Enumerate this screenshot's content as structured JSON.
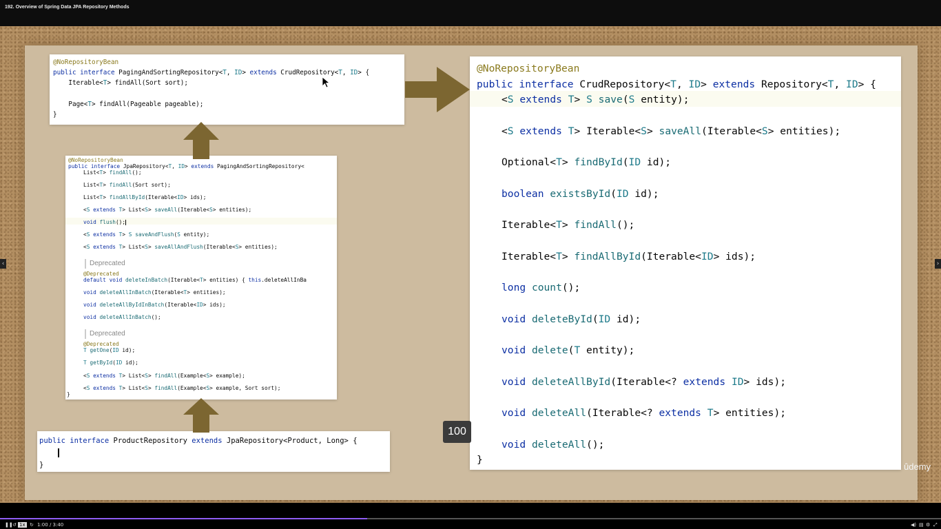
{
  "video": {
    "title": "192. Overview of Spring Data JPA Repository Methods",
    "speed_badge": "100",
    "watermark": "ûdemy",
    "progress": 0.39,
    "playback_rate": "1x",
    "time": "1:00 / 3:40"
  },
  "paging_panel": {
    "annotation": "@NoRepositoryBean",
    "decl": [
      "public interface ",
      "PagingAndSortingRepository",
      "<",
      "T",
      ", ",
      "ID",
      "> ",
      "extends",
      " CrudRepository<",
      "T",
      ", ",
      "ID",
      "> {"
    ],
    "lines": [
      [
        "    Iterable<",
        "T",
        "> findAll(Sort sort);"
      ],
      [
        "    Page<",
        "T",
        "> findAll(Pageable pageable);"
      ]
    ],
    "close": "}"
  },
  "jpa_panel": {
    "annotation": "@NoRepositoryBean",
    "decl": [
      "public interface ",
      "JpaRepository<",
      "T",
      ", ",
      "ID",
      "> ",
      "extends",
      " PagingAndSortingRepository<"
    ],
    "lines": [
      [
        "List<",
        "T",
        "> ",
        "findAll",
        "();"
      ],
      [
        "List<",
        "T",
        "> ",
        "findAll",
        "(Sort sort);"
      ],
      [
        "List<",
        "T",
        "> ",
        "findAllById",
        "(Iterable<",
        "ID",
        "> ids);"
      ],
      [
        "<",
        "S",
        " ",
        "extends",
        " ",
        "T",
        "> List<",
        "S",
        "> ",
        "saveAll",
        "(Iterable<",
        "S",
        "> entities);"
      ],
      [
        "void",
        " ",
        "flush",
        "();"
      ],
      [
        "<",
        "S",
        " ",
        "extends",
        " ",
        "T",
        "> ",
        "S",
        " ",
        "saveAndFlush",
        "(",
        "S",
        " entity);"
      ],
      [
        "<",
        "S",
        " ",
        "extends",
        " ",
        "T",
        "> List<",
        "S",
        "> ",
        "saveAllAndFlush",
        "(Iterable<",
        "S",
        "> entities);"
      ],
      [
        "default",
        " ",
        "void",
        " ",
        "deleteInBatch",
        "(Iterable<",
        "T",
        "> entities) { ",
        "this",
        ".deleteAllInBa"
      ],
      [
        "void",
        " ",
        "deleteAllInBatch",
        "(Iterable<",
        "T",
        "> entities);"
      ],
      [
        "void",
        " ",
        "deleteAllByIdInBatch",
        "(Iterable<",
        "ID",
        "> ids);"
      ],
      [
        "void",
        " ",
        "deleteAllInBatch",
        "();"
      ],
      [
        "T",
        " ",
        "getOne",
        "(",
        "ID",
        " id);"
      ],
      [
        "T",
        " ",
        "getById",
        "(",
        "ID",
        " id);"
      ],
      [
        "<",
        "S",
        " ",
        "extends",
        " ",
        "T",
        "> List<",
        "S",
        "> ",
        "findAll",
        "(Example<",
        "S",
        "> example);"
      ],
      [
        "<",
        "S",
        " ",
        "extends",
        " ",
        "T",
        "> List<",
        "S",
        "> ",
        "findAll",
        "(Example<",
        "S",
        "> example, Sort sort);"
      ]
    ],
    "deprecated_label_1": "Deprecated",
    "deprecated_label_2": "Deprecated",
    "deprecated_ann_1": "@Deprecated",
    "deprecated_ann_2": "@Deprecated",
    "close": "}"
  },
  "product_panel": {
    "decl": [
      "public",
      " ",
      "interface",
      " ProductRepository ",
      "extends",
      " JpaRepository<Product, Long> {"
    ],
    "close": "}"
  },
  "crud_panel": {
    "annotation": "@NoRepositoryBean",
    "decl": [
      "public interface ",
      "CrudRepository<",
      "T",
      ", ",
      "ID",
      "> ",
      "extends",
      " Repository<",
      "T",
      ", ",
      "ID",
      "> {"
    ],
    "lines": [
      [
        "<",
        "S",
        " ",
        "extends",
        " ",
        "T",
        "> ",
        "S",
        " ",
        "save",
        "(",
        "S",
        " entity);"
      ],
      [
        "<",
        "S",
        " ",
        "extends",
        " ",
        "T",
        "> Iterable<",
        "S",
        "> ",
        "saveAll",
        "(Iterable<",
        "S",
        "> entities);"
      ],
      [
        "Optional<",
        "T",
        "> ",
        "findById",
        "(",
        "ID",
        " id);"
      ],
      [
        "boolean",
        " ",
        "existsById",
        "(",
        "ID",
        " id);"
      ],
      [
        "Iterable<",
        "T",
        "> ",
        "findAll",
        "();"
      ],
      [
        "Iterable<",
        "T",
        "> ",
        "findAllById",
        "(Iterable<",
        "ID",
        "> ids);"
      ],
      [
        "long",
        " ",
        "count",
        "();"
      ],
      [
        "void",
        " ",
        "deleteById",
        "(",
        "ID",
        " id);"
      ],
      [
        "void",
        " ",
        "delete",
        "(",
        "T",
        " entity);"
      ],
      [
        "void",
        " ",
        "deleteAllById",
        "(Iterable<? ",
        "extends",
        " ",
        "ID",
        "> ids);"
      ],
      [
        "void",
        " ",
        "deleteAll",
        "(Iterable<? ",
        "extends",
        " ",
        "T",
        "> entities);"
      ],
      [
        "void",
        " ",
        "deleteAll",
        "();"
      ]
    ],
    "close": "}"
  },
  "colors": {
    "keyword": "#0c2fa3",
    "annotation": "#8a7a1e",
    "type_param": "#1d7a8a",
    "method": "#196a73",
    "arrow": "#7c6631"
  }
}
